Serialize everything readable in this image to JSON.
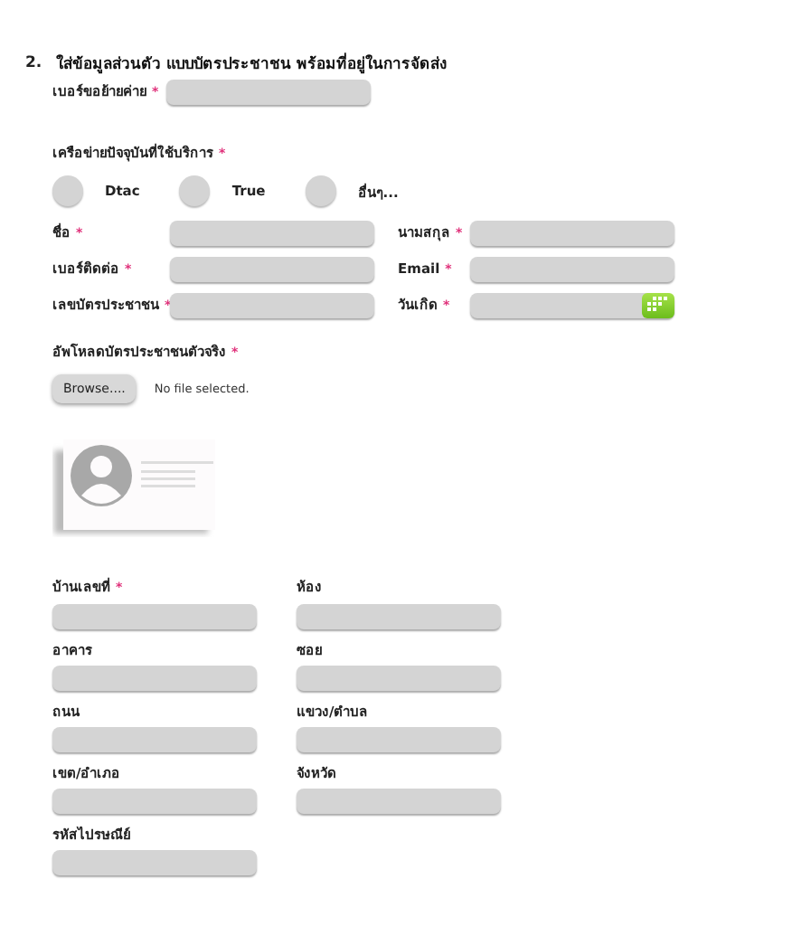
{
  "section": {
    "number": "2.",
    "title": "ใส่ข้อมูลส่วนตัว แบบบัตรประชาชน พร้อมที่อยู่ในการจัดส่ง"
  },
  "transfer_number": {
    "label": "เบอร์ขอย้ายค่าย",
    "required_mark": "*"
  },
  "network": {
    "label": "เครือข่ายปัจจุบันที่ใช้บริการ",
    "required_mark": "*",
    "options": [
      {
        "label": "Dtac",
        "selected": false
      },
      {
        "label": "True",
        "selected": false
      },
      {
        "label": "อื่นๆ...",
        "selected": false
      }
    ]
  },
  "personal": [
    {
      "label": "ชื่อ",
      "required_mark": "*",
      "kind": "text"
    },
    {
      "label": "นามสกุล",
      "required_mark": "*",
      "kind": "text"
    },
    {
      "label": "เบอร์ติดต่อ",
      "required_mark": "*",
      "kind": "text"
    },
    {
      "label": "Email",
      "required_mark": "*",
      "kind": "text"
    },
    {
      "label": "เลขบัตรประชาชน",
      "required_mark": "*",
      "kind": "text"
    },
    {
      "label": "วันเกิด",
      "required_mark": "*",
      "kind": "date"
    }
  ],
  "upload": {
    "label": "อัพโหลดบัตรประชาชนตัวจริง",
    "required_mark": "*",
    "button": "Browse....",
    "status": "No file selected."
  },
  "address": [
    {
      "label": "บ้านเลขที่",
      "required_mark": "*"
    },
    {
      "label": "ห้อง"
    },
    {
      "label": "อาคาร"
    },
    {
      "label": "ซอย"
    },
    {
      "label": "ถนน"
    },
    {
      "label": "แขวง/ตำบล"
    },
    {
      "label": "เขต/อำเภอ"
    },
    {
      "label": "จังหวัด"
    },
    {
      "label": "รหัสไปรษณีย์"
    }
  ]
}
